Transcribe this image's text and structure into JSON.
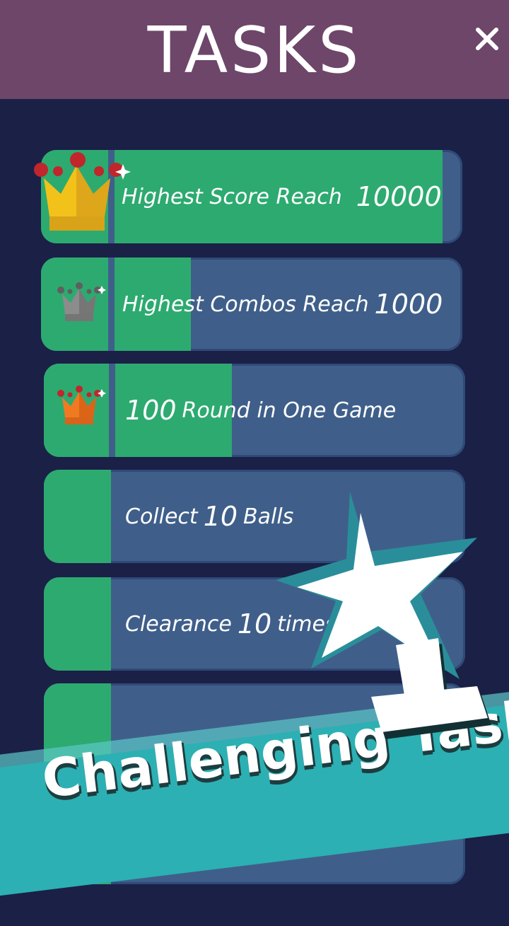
{
  "header": {
    "title": "TASKS",
    "close_icon": "close-icon"
  },
  "tasks": [
    {
      "pre": "Highest Score Reach",
      "num": "10000",
      "post": "",
      "progress": 0.97,
      "icon": "gold-crown-icon"
    },
    {
      "pre": "Highest Combos Reach",
      "num": "1000",
      "post": "",
      "progress": 0.36,
      "icon": "gray-crown-icon"
    },
    {
      "pre": "",
      "num": "100",
      "post": "Round in One Game",
      "progress": 0.45,
      "icon": "orange-crown-icon"
    },
    {
      "pre": "Collect",
      "num": "10",
      "post": "Balls",
      "progress": 0.0,
      "icon": ""
    },
    {
      "pre": "Clearance",
      "num": "10",
      "post": "times",
      "progress": 0.0,
      "icon": ""
    },
    {
      "pre": "",
      "num": "",
      "post": "",
      "progress": 0.0,
      "icon": ""
    }
  ],
  "banner": {
    "text": "Challenging Tasks!",
    "icon": "star-trophy-icon"
  },
  "colors": {
    "header": "#6e466a",
    "background": "#1b2047",
    "task_bg": "#3f5f8a",
    "progress": "#2daa70",
    "banner": "#2cb0b3"
  }
}
